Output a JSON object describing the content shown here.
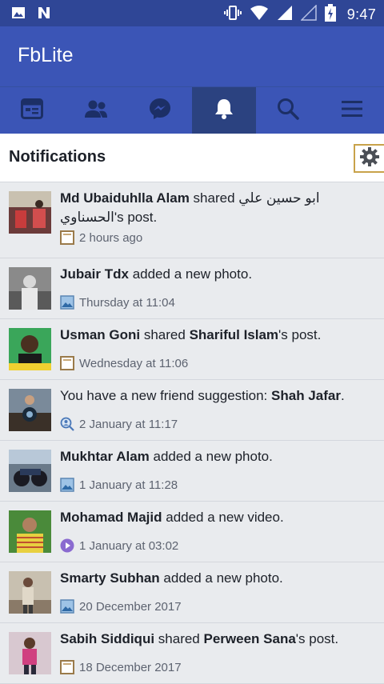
{
  "status_bar": {
    "time": "9:47"
  },
  "app": {
    "title": "FbLite"
  },
  "tabs": [
    {
      "icon": "news-feed-icon"
    },
    {
      "icon": "friends-icon"
    },
    {
      "icon": "messenger-icon"
    },
    {
      "icon": "notifications-bell-icon",
      "active": true
    },
    {
      "icon": "search-icon"
    },
    {
      "icon": "menu-icon"
    }
  ],
  "header": {
    "title": "Notifications"
  },
  "notifications": [
    {
      "actor": "Md Ubaiduhlla Alam",
      "verb": " shared ",
      "target": "ابو حسين علي الحسناوي",
      "suffix": "'s post.",
      "time": "2 hours ago",
      "type_icon": "post-icon"
    },
    {
      "actor": "Jubair Tdx",
      "verb": " added a new photo.",
      "target": "",
      "suffix": "",
      "time": "Thursday at 11:04",
      "type_icon": "photo-icon"
    },
    {
      "actor": "Usman Goni",
      "verb": " shared ",
      "target": "Shariful Islam",
      "suffix": "'s post.",
      "time": "Wednesday at 11:06",
      "type_icon": "post-icon"
    },
    {
      "prefix": "You have a new friend suggestion: ",
      "actor": "Shah Jafar",
      "verb": ".",
      "target": "",
      "suffix": "",
      "time": "2 January at 11:17",
      "type_icon": "friend-suggestion-icon"
    },
    {
      "actor": "Mukhtar Alam",
      "verb": " added a new photo.",
      "target": "",
      "suffix": "",
      "time": "1 January at 11:28",
      "type_icon": "photo-icon"
    },
    {
      "actor": "Mohamad Majid",
      "verb": " added a new video.",
      "target": "",
      "suffix": "",
      "time": "1 January at 03:02",
      "type_icon": "video-icon"
    },
    {
      "actor": "Smarty Subhan",
      "verb": " added a new photo.",
      "target": "",
      "suffix": "",
      "time": "20 December 2017",
      "type_icon": "photo-icon"
    },
    {
      "actor": "Sabih Siddiqui",
      "verb": " shared ",
      "target": "Perween Sana",
      "suffix": "'s post.",
      "time": "18 December 2017",
      "type_icon": "post-icon"
    }
  ]
}
